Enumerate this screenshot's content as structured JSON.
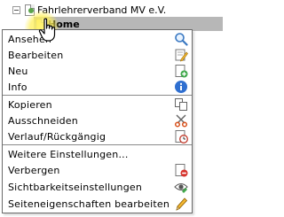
{
  "tree": {
    "root_label": "Fahrlehrerverband MV e.V.",
    "home_label": "Home"
  },
  "menu": {
    "items": [
      {
        "label": "Ansehen",
        "icon": "magnifier-icon"
      },
      {
        "label": "Bearbeiten",
        "icon": "edit-page-icon"
      },
      {
        "label": "Neu",
        "icon": "new-page-icon"
      },
      {
        "label": "Info",
        "icon": "info-icon"
      },
      {
        "label": "Kopieren",
        "icon": "copy-icon"
      },
      {
        "label": "Ausschneiden",
        "icon": "scissors-icon"
      },
      {
        "label": "Verlauf/Rückgängig",
        "icon": "history-icon"
      },
      {
        "label": "Weitere Einstellungen...",
        "icon": ""
      },
      {
        "label": "Verbergen",
        "icon": "hide-page-icon"
      },
      {
        "label": "Sichtbarkeitseinstellungen",
        "icon": "visibility-icon"
      },
      {
        "label": "Seiteneigenschaften bearbeiten",
        "icon": "pencil-icon"
      }
    ]
  },
  "colors": {
    "selected_row": "#b7b7b7",
    "cursor_halo": "#fff05a",
    "menu_border": "#6b6b6b"
  }
}
